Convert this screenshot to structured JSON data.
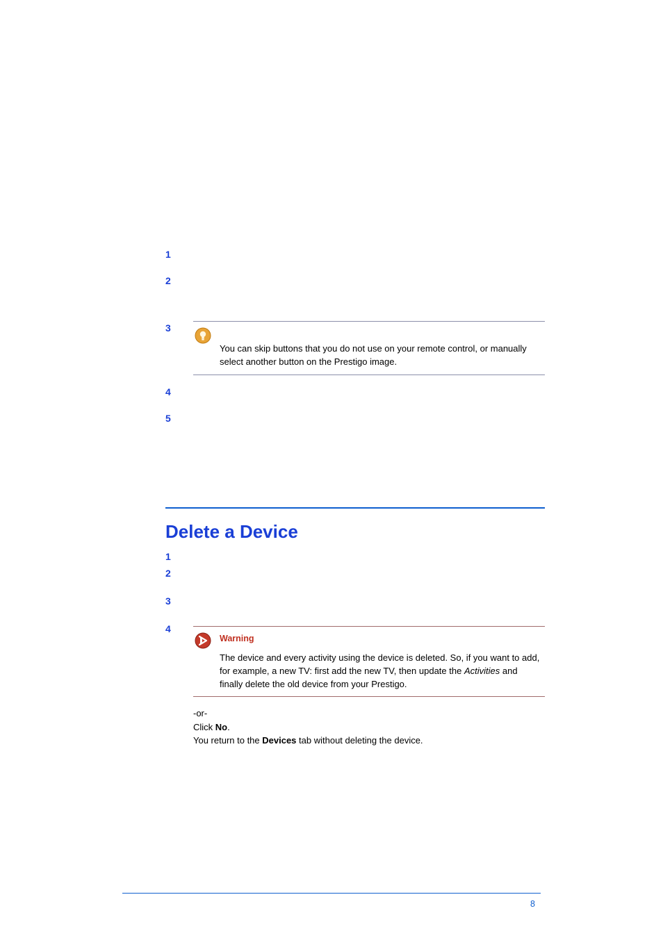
{
  "steps_top": [
    {
      "num": "1",
      "kind": "blank"
    },
    {
      "num": "2",
      "kind": "blank"
    },
    {
      "num": "3",
      "kind": "tip",
      "tip": "You can skip buttons that you do not use on your remote control, or manually select another button on the Prestigo image."
    },
    {
      "num": "4",
      "kind": "blank"
    },
    {
      "num": "5",
      "kind": "blank"
    }
  ],
  "section_title": "Delete a Device",
  "steps_bottom": [
    {
      "num": "1",
      "kind": "blank"
    },
    {
      "num": "2",
      "kind": "blank"
    },
    {
      "num": "3",
      "kind": "blank"
    },
    {
      "num": "4",
      "kind": "warning",
      "heading": "Warning",
      "warn_pre": "The device and every activity using the device is deleted. So, if you want to add, for example, a new TV: first add the new TV, then update the ",
      "warn_italic": "Activities",
      "warn_post": " and finally delete the old device from your Prestigo."
    }
  ],
  "tail_or": "-or-",
  "tail_click": "Click ",
  "tail_no": "No",
  "tail_click_post": ".",
  "tail_return_pre": "You return to the ",
  "tail_devices": "Devices",
  "tail_return_post": " tab without deleting the device.",
  "page_number": "8"
}
